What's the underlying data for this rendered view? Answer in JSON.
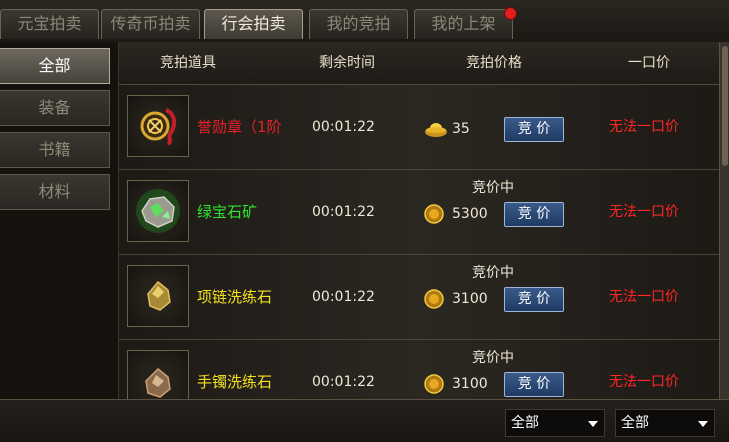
{
  "tabs": [
    {
      "label": "元宝拍卖",
      "active": false
    },
    {
      "label": "传奇币拍卖",
      "active": false
    },
    {
      "label": "行会拍卖",
      "active": true
    },
    {
      "label": "我的竞拍",
      "active": false
    },
    {
      "label": "我的上架",
      "active": false,
      "has_notification": true
    }
  ],
  "categories": [
    {
      "label": "全部",
      "active": true
    },
    {
      "label": "装备",
      "active": false
    },
    {
      "label": "书籍",
      "active": false
    },
    {
      "label": "材料",
      "active": false
    }
  ],
  "columns": {
    "item": "竞拍道具",
    "time": "剩余时间",
    "price": "竞拍价格",
    "buyout": "一口价"
  },
  "items": [
    {
      "name": "誉勋章（1阶",
      "name_color": "#e8202a",
      "icon": "medal-icon",
      "time": "00:01:22",
      "status": "",
      "currency": "gold-ingot-icon",
      "price": "35",
      "bid_label": "竞 价",
      "buyout": "无法一口价"
    },
    {
      "name": "绿宝石矿",
      "name_color": "#2ee62e",
      "icon": "green-gem-ore-icon",
      "time": "00:01:22",
      "status": "竞价中",
      "currency": "gold-coin-icon",
      "price": "5300",
      "bid_label": "竞 价",
      "buyout": "无法一口价"
    },
    {
      "name": "项链洗练石",
      "name_color": "#f4e11e",
      "icon": "refine-stone-icon",
      "time": "00:01:22",
      "status": "竞价中",
      "currency": "gold-coin-icon",
      "price": "3100",
      "bid_label": "竞 价",
      "buyout": "无法一口价"
    },
    {
      "name": "手镯洗练石",
      "name_color": "#f4e11e",
      "icon": "refine-stone-icon",
      "time": "00:01:22",
      "status": "竞价中",
      "currency": "gold-coin-icon",
      "price": "3100",
      "bid_label": "竞 价",
      "buyout": "无法一口价"
    }
  ],
  "filters": [
    {
      "selected": "全部"
    },
    {
      "selected": "全部"
    }
  ]
}
